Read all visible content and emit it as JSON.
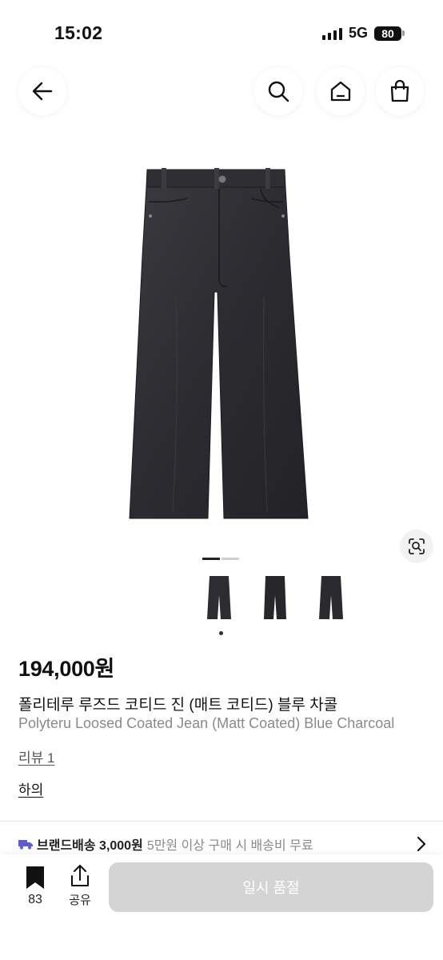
{
  "status_bar": {
    "time": "15:02",
    "network": "5G",
    "battery": "80"
  },
  "nav": {
    "back_icon": "arrow-left-icon",
    "search_icon": "search-icon",
    "home_icon": "home-icon",
    "bag_icon": "shopping-bag-icon"
  },
  "gallery": {
    "image_count": 3,
    "current_index": 1
  },
  "product": {
    "price": "194,000원",
    "name_ko": "폴리테루 루즈드 코티드 진 (매트 코티드) 블루 차콜",
    "name_en": "Polyteru Loosed Coated Jean (Matt Coated) Blue Charcoal",
    "review_link": "리뷰 1",
    "category_link": "하의"
  },
  "shipping": {
    "main": "브랜드배송 3,000원",
    "sub": "5만원 이상 구매 시 배송비 무료",
    "icon_color": "#5b5bd6"
  },
  "bottom_bar": {
    "bookmark_count": "83",
    "share_label": "공유",
    "action_label": "일시 품절"
  }
}
